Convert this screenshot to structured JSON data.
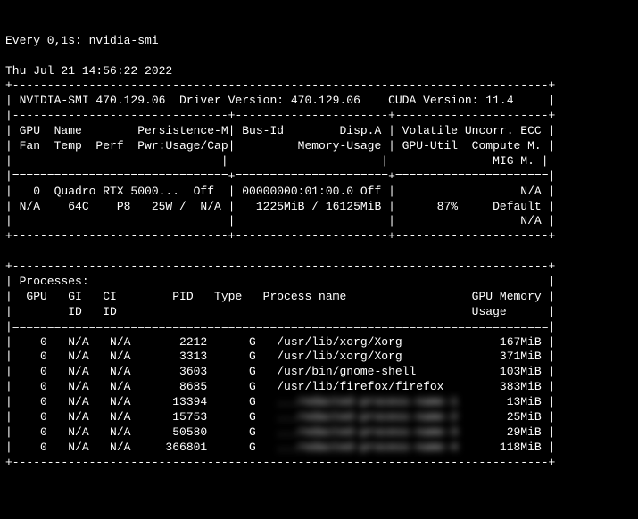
{
  "watch_line": "Every 0,1s: nvidia-smi",
  "timestamp": "Thu Jul 21 14:56:22 2022",
  "smi_version": "NVIDIA-SMI 470.129.06",
  "driver_version": "Driver Version: 470.129.06",
  "cuda_version": "CUDA Version: 11.4",
  "headers": {
    "row1_left": "GPU  Name        Persistence-M",
    "row1_mid": "Bus-Id        Disp.A",
    "row1_right": "Volatile Uncorr. ECC",
    "row2_left": "Fan  Temp  Perf  Pwr:Usage/Cap",
    "row2_mid": "Memory-Usage",
    "row2_right": "GPU-Util  Compute M.",
    "row3_right": "MIG M."
  },
  "gpu": {
    "id": "0",
    "name": "Quadro RTX 5000...",
    "persist": "Off",
    "bus_id": "00000000:01:00.0",
    "disp_a": "Off",
    "ecc": "N/A",
    "fan": "N/A",
    "temp": "64C",
    "perf": "P8",
    "pwr": "25W /  N/A",
    "mem": "1225MiB / 16125MiB",
    "util": "87%",
    "compute": "Default",
    "mig": "N/A"
  },
  "proc_header": {
    "title": "Processes:",
    "cols1": "GPU   GI   CI        PID   Type   Process name                  GPU Memory",
    "cols2": "      ID   ID                                                   Usage"
  },
  "processes": [
    {
      "gpu": "0",
      "gi": "N/A",
      "ci": "N/A",
      "pid": "2212",
      "type": "G",
      "name": "/usr/lib/xorg/Xorg",
      "mem": "167MiB",
      "blur": false
    },
    {
      "gpu": "0",
      "gi": "N/A",
      "ci": "N/A",
      "pid": "3313",
      "type": "G",
      "name": "/usr/lib/xorg/Xorg",
      "mem": "371MiB",
      "blur": false
    },
    {
      "gpu": "0",
      "gi": "N/A",
      "ci": "N/A",
      "pid": "3603",
      "type": "G",
      "name": "/usr/bin/gnome-shell",
      "mem": "103MiB",
      "blur": false
    },
    {
      "gpu": "0",
      "gi": "N/A",
      "ci": "N/A",
      "pid": "8685",
      "type": "G",
      "name": "/usr/lib/firefox/firefox",
      "mem": "383MiB",
      "blur": false
    },
    {
      "gpu": "0",
      "gi": "N/A",
      "ci": "N/A",
      "pid": "13394",
      "type": "G",
      "name": "...redacted-process-name-1",
      "mem": "13MiB",
      "blur": true
    },
    {
      "gpu": "0",
      "gi": "N/A",
      "ci": "N/A",
      "pid": "15753",
      "type": "G",
      "name": "...redacted-process-name-2",
      "mem": "25MiB",
      "blur": true
    },
    {
      "gpu": "0",
      "gi": "N/A",
      "ci": "N/A",
      "pid": "50580",
      "type": "G",
      "name": "...redacted-process-name-3",
      "mem": "29MiB",
      "blur": true
    },
    {
      "gpu": "0",
      "gi": "N/A",
      "ci": "N/A",
      "pid": "366801",
      "type": "G",
      "name": "...redacted-process-name-4",
      "mem": "118MiB",
      "blur": true
    }
  ]
}
